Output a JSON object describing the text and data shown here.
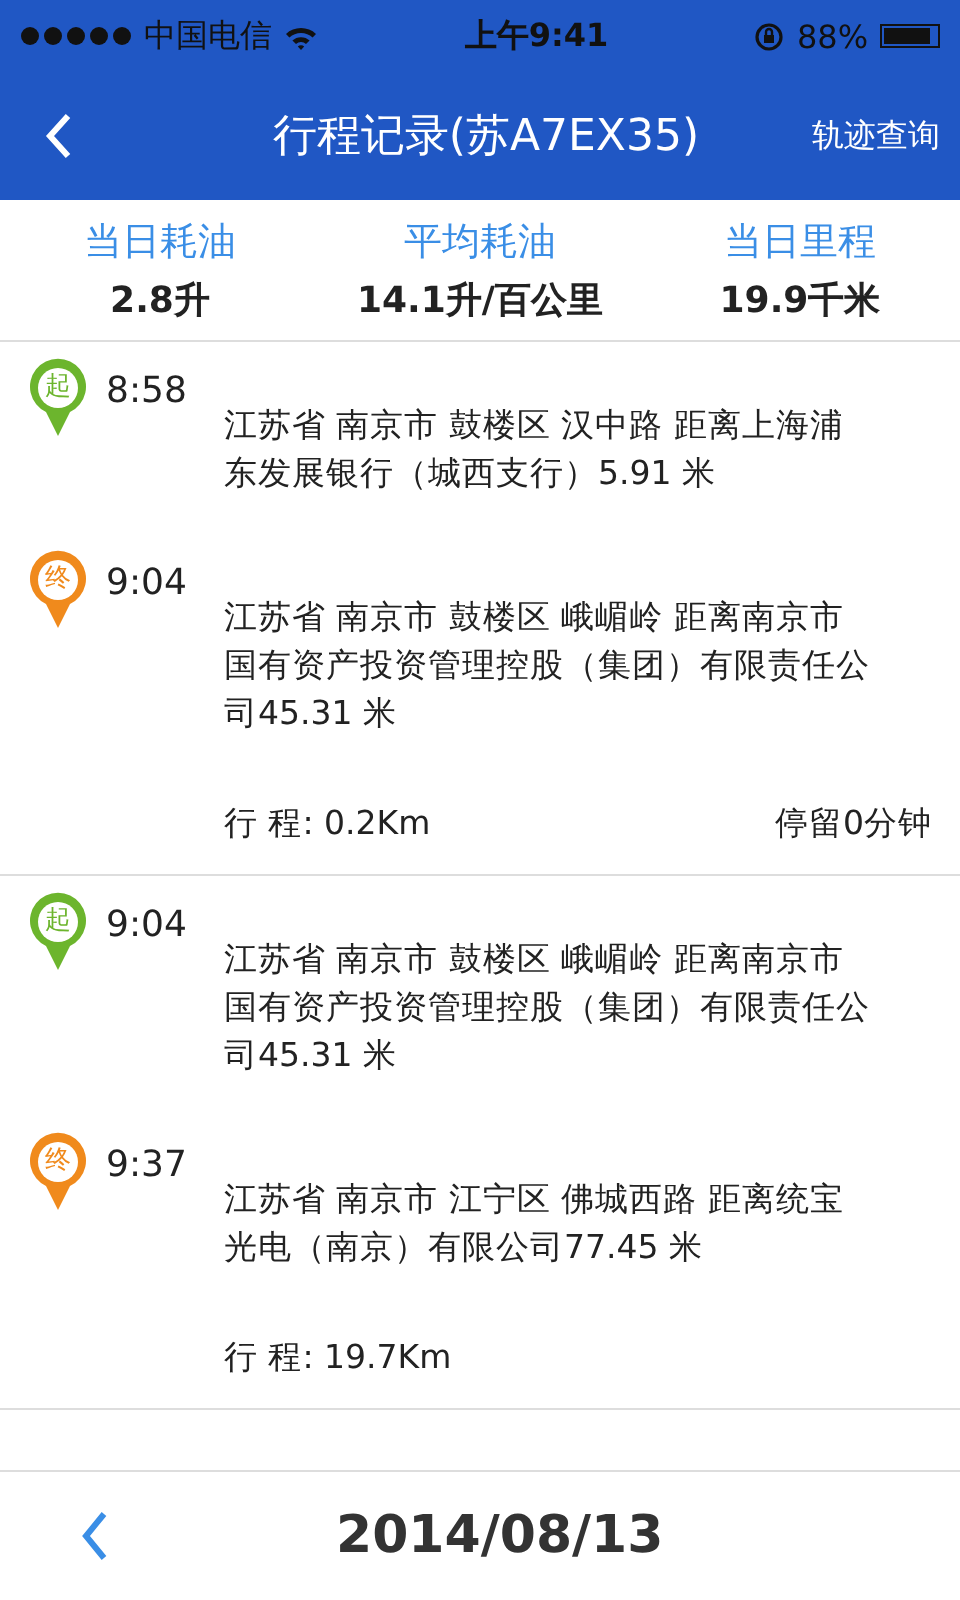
{
  "status_bar": {
    "carrier": "中国电信",
    "time": "上午9:41",
    "battery": "88%"
  },
  "header": {
    "title": "行程记录(苏A7EX35)",
    "action": "轨迹查询"
  },
  "stats": [
    {
      "label": "当日耗油",
      "value": "2.8升"
    },
    {
      "label": "平均耗油",
      "value": "14.1升/百公里"
    },
    {
      "label": "当日里程",
      "value": "19.9千米"
    }
  ],
  "trips": [
    {
      "points": [
        {
          "kind": "start",
          "pin": "起",
          "time": "8:58",
          "address": "江苏省 南京市 鼓楼区 汉中路  距离上海浦东发展银行（城西支行）5.91 米"
        },
        {
          "kind": "end",
          "pin": "终",
          "time": "9:04",
          "address": "江苏省 南京市 鼓楼区 峨嵋岭  距离南京市国有资产投资管理控股（集团）有限责任公司45.31 米"
        }
      ],
      "distance": "行 程:  0.2Km",
      "stay": "停留0分钟"
    },
    {
      "points": [
        {
          "kind": "start",
          "pin": "起",
          "time": "9:04",
          "address": "江苏省 南京市 鼓楼区 峨嵋岭  距离南京市国有资产投资管理控股（集团）有限责任公司45.31 米"
        },
        {
          "kind": "end",
          "pin": "终",
          "time": "9:37",
          "address": "江苏省 南京市 江宁区 佛城西路  距离统宝光电（南京）有限公司77.45 米"
        }
      ],
      "distance": "行 程:  19.7Km"
    }
  ],
  "footer": {
    "date": "2014/08/13"
  }
}
